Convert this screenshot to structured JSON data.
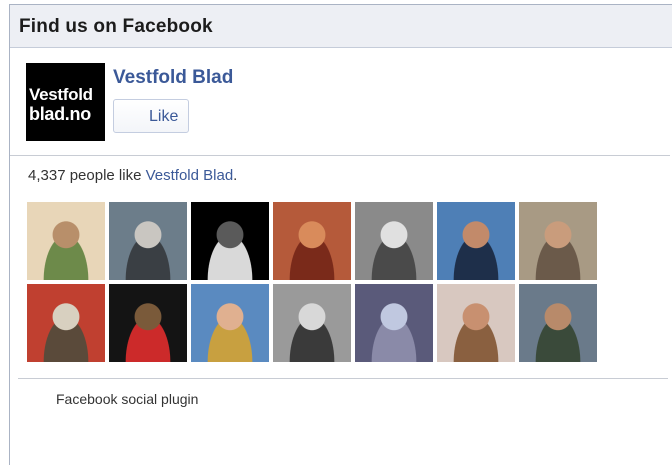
{
  "header": {
    "title": "Find us on Facebook"
  },
  "page": {
    "name": "Vestfold Blad",
    "logo_text_line1": "Vestfold",
    "logo_text_line2": "blad.no",
    "like_button_label": "Like"
  },
  "likes": {
    "count_text": "4,337 people like ",
    "page_link": "Vestfold Blad",
    "suffix": "."
  },
  "faces": [
    {
      "name": "face-1",
      "colors": [
        "#e8d6b8",
        "#b88f6a",
        "#6d8a4a"
      ]
    },
    {
      "name": "face-2",
      "colors": [
        "#6c7d8a",
        "#c9c6c1",
        "#3a3f44"
      ]
    },
    {
      "name": "face-3",
      "colors": [
        "#000000",
        "#5a5a5a",
        "#d9d9d9"
      ]
    },
    {
      "name": "face-4",
      "colors": [
        "#b55a3a",
        "#d98b5b",
        "#7a2a1a"
      ]
    },
    {
      "name": "face-5",
      "colors": [
        "#8a8a8a",
        "#e0e0e0",
        "#4a4a4a"
      ]
    },
    {
      "name": "face-6",
      "colors": [
        "#4e7fb6",
        "#c28a6a",
        "#1e2f4a"
      ]
    },
    {
      "name": "face-7",
      "colors": [
        "#a89a84",
        "#c99c7c",
        "#6b5a4a"
      ]
    },
    {
      "name": "face-8",
      "colors": [
        "#c04030",
        "#d8d0c0",
        "#5a4a3a"
      ]
    },
    {
      "name": "face-9",
      "colors": [
        "#141414",
        "#7a5a3a",
        "#cc2a2a"
      ]
    },
    {
      "name": "face-10",
      "colors": [
        "#5a8ac0",
        "#e0b090",
        "#c8a040"
      ]
    },
    {
      "name": "face-11",
      "colors": [
        "#9a9a9a",
        "#d8d8d8",
        "#3a3a3a"
      ]
    },
    {
      "name": "face-12",
      "colors": [
        "#5a5a7a",
        "#c0c8e0",
        "#8a8aa8"
      ]
    },
    {
      "name": "face-13",
      "colors": [
        "#d8c8c0",
        "#c89070",
        "#8a6040"
      ]
    },
    {
      "name": "face-14",
      "colors": [
        "#6a7a8a",
        "#b88a6a",
        "#3a4a3a"
      ]
    }
  ],
  "footer": {
    "text": "Facebook social plugin"
  },
  "colors": {
    "link": "#3b5998",
    "header_bg": "#edeff4",
    "border": "#aab3c4"
  }
}
